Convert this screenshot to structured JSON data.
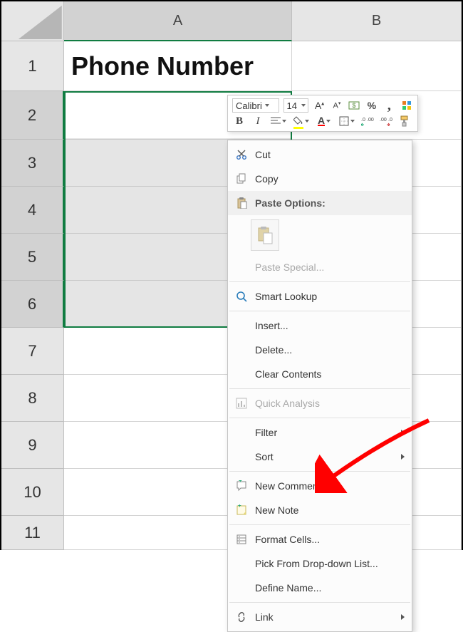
{
  "columns": [
    "A",
    "B"
  ],
  "rows": [
    "1",
    "2",
    "3",
    "4",
    "5",
    "6",
    "7",
    "8",
    "9",
    "10",
    "11"
  ],
  "cell_a1": "Phone Number",
  "mini_toolbar": {
    "font_name": "Calibri",
    "font_size": "14",
    "bold_label": "B",
    "italic_label": "I",
    "increase_font_label": "A",
    "decrease_font_label": "A",
    "percent_label": "%",
    "comma_label": ",",
    "fill_letter": "A",
    "font_color_letter": "A"
  },
  "context_menu": {
    "cut": "Cut",
    "copy": "Copy",
    "paste_options": "Paste Options:",
    "paste_special": "Paste Special...",
    "smart_lookup": "Smart Lookup",
    "insert": "Insert...",
    "delete": "Delete...",
    "clear_contents": "Clear Contents",
    "quick_analysis": "Quick Analysis",
    "filter": "Filter",
    "sort": "Sort",
    "new_comment": "New Comment",
    "new_note": "New Note",
    "format_cells": "Format Cells...",
    "pick_from_list": "Pick From Drop-down List...",
    "define_name": "Define Name...",
    "link": "Link"
  },
  "selection": {
    "active_cell": "A2",
    "range": "A2:A6"
  },
  "colors": {
    "selection_border": "#107c41",
    "header_bg": "#e6e6e6",
    "arrow": "#ff0000"
  }
}
